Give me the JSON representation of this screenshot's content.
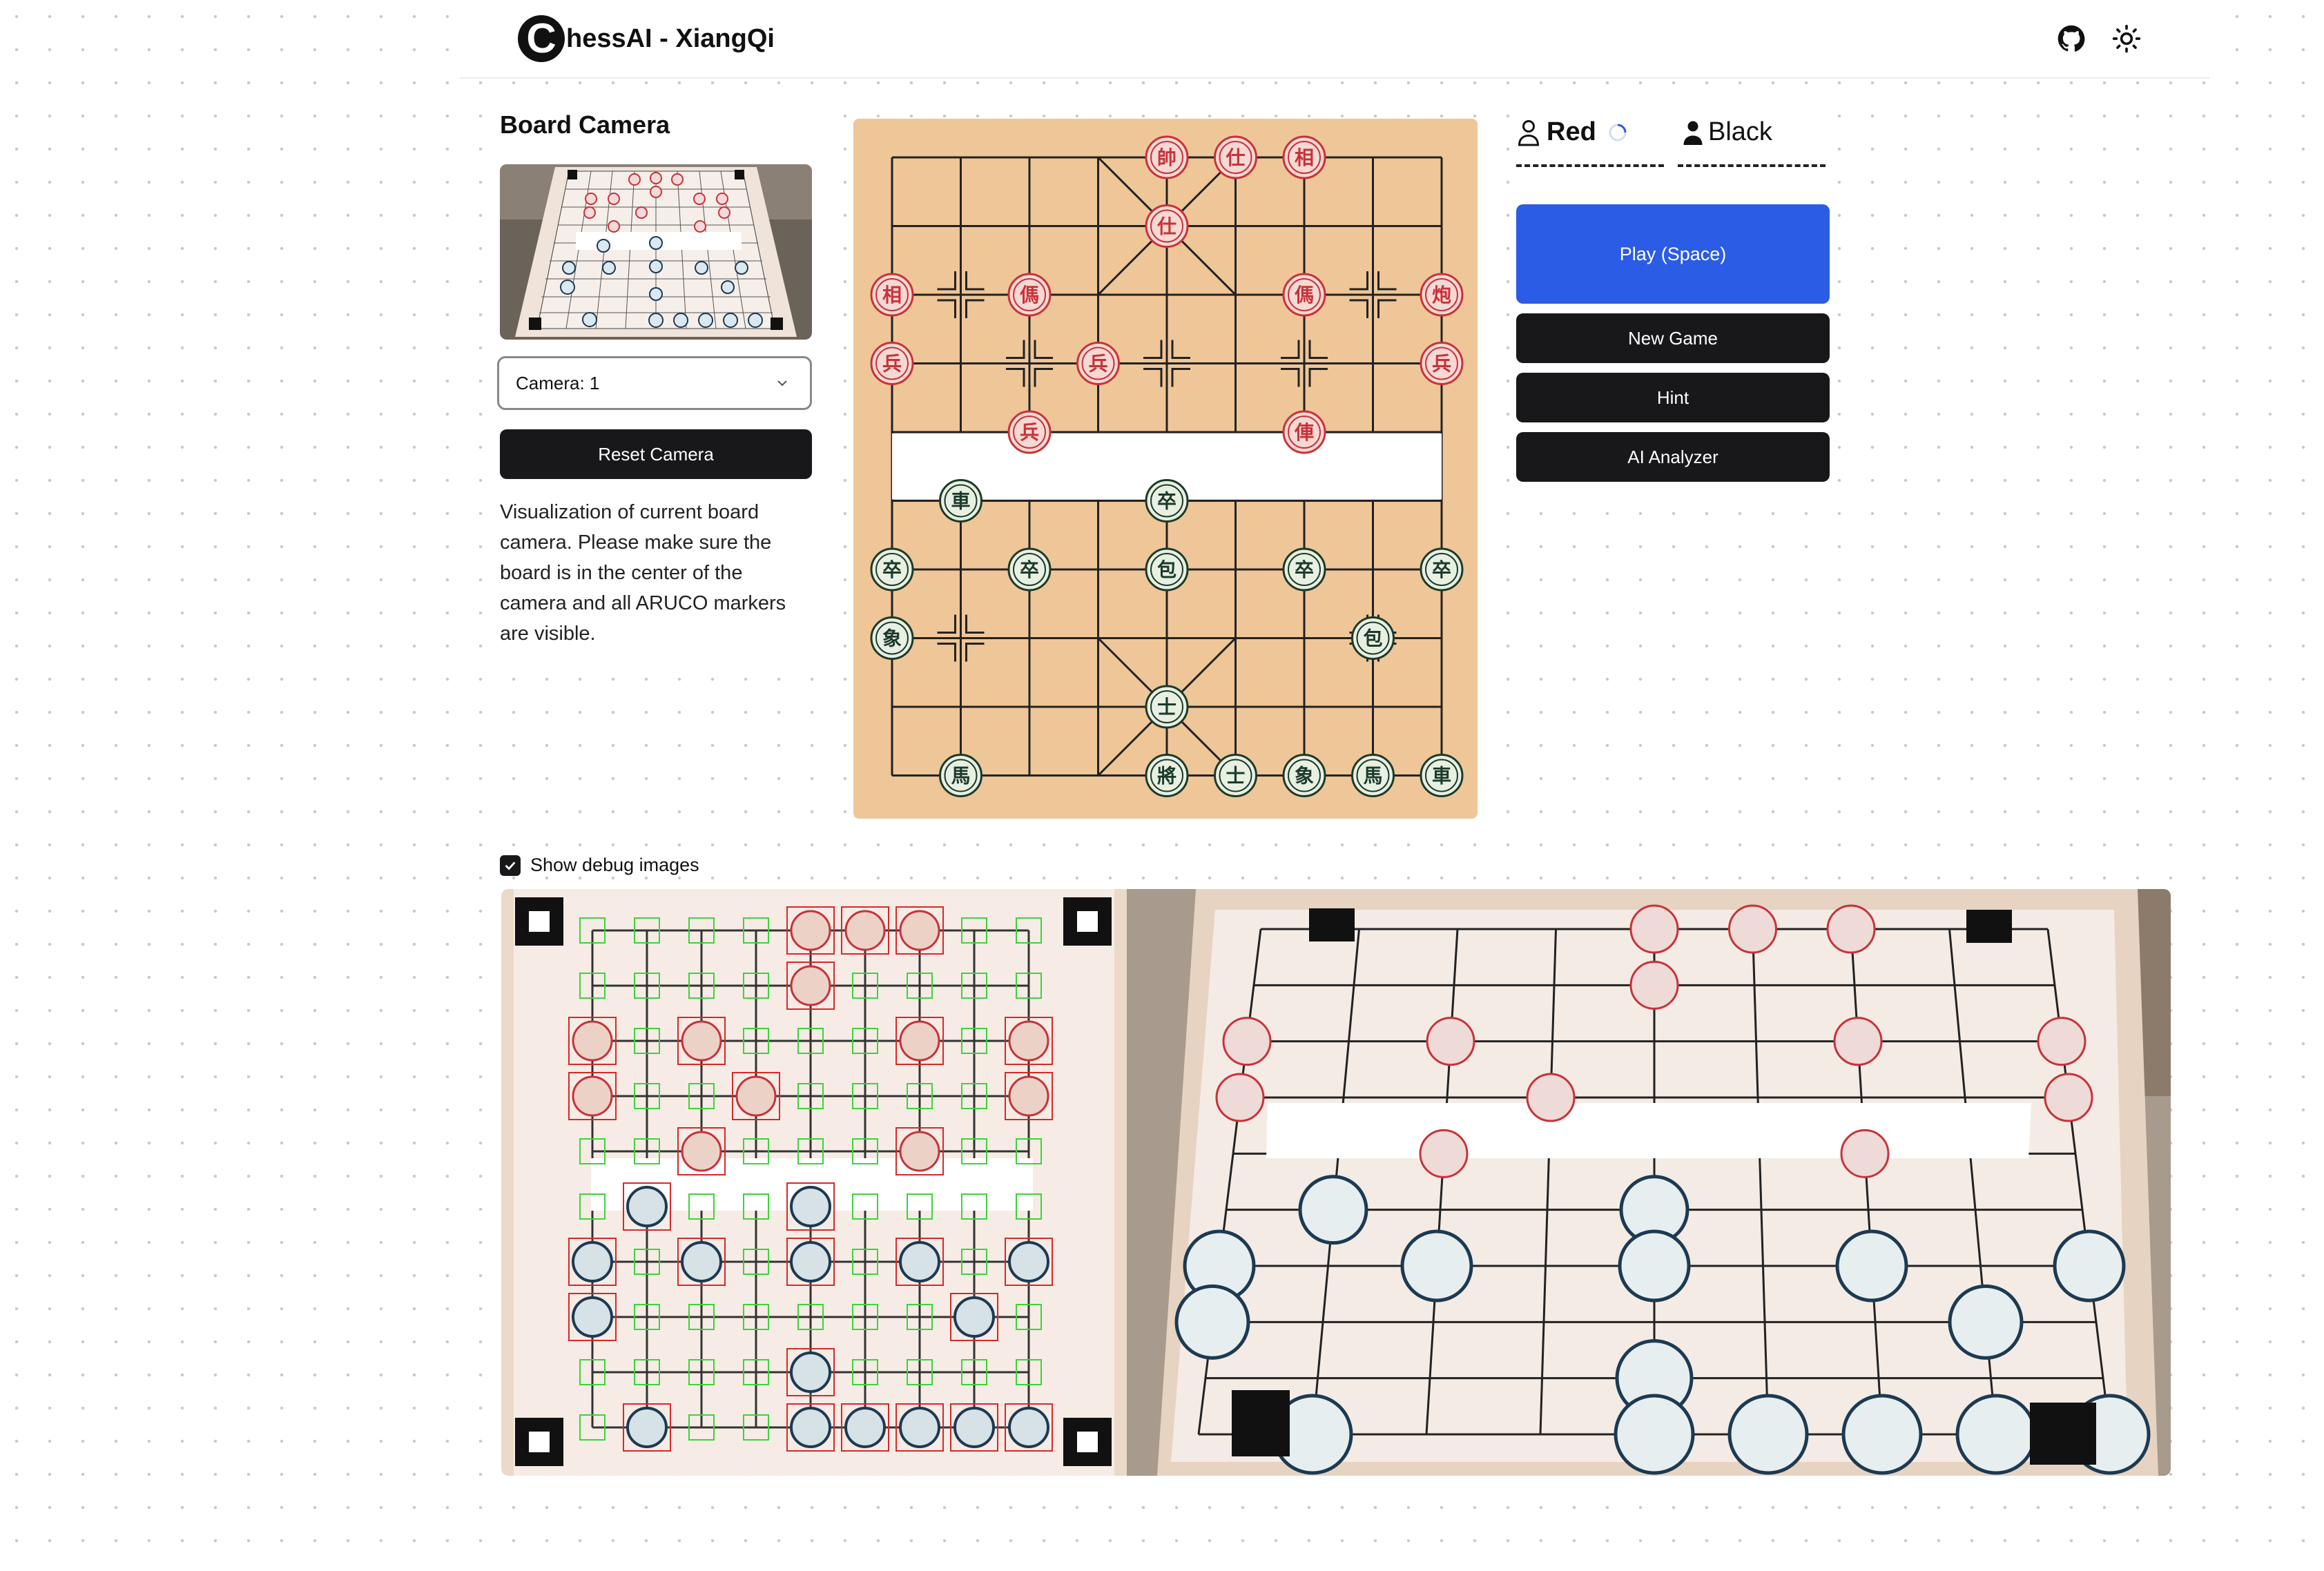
{
  "header": {
    "logo_letter": "C",
    "title": "hessAI - XiangQi",
    "github_icon": "github-icon",
    "theme_icon": "sun-icon"
  },
  "camera_panel": {
    "title": "Board Camera",
    "select_value": "Camera: 1",
    "reset_label": "Reset Camera",
    "description": "Visualization of current board camera. Please make sure the board is in the center of the camera and all ARUCO markers are visible."
  },
  "board": {
    "red_pieces": [
      {
        "col": 4,
        "row": 0,
        "label": "帥"
      },
      {
        "col": 5,
        "row": 0,
        "label": "仕"
      },
      {
        "col": 6,
        "row": 0,
        "label": "相"
      },
      {
        "col": 4,
        "row": 1,
        "label": "仕"
      },
      {
        "col": 0,
        "row": 2,
        "label": "相"
      },
      {
        "col": 2,
        "row": 2,
        "label": "傌"
      },
      {
        "col": 6,
        "row": 2,
        "label": "傌"
      },
      {
        "col": 8,
        "row": 2,
        "label": "炮"
      },
      {
        "col": 0,
        "row": 3,
        "label": "兵"
      },
      {
        "col": 3,
        "row": 3,
        "label": "兵"
      },
      {
        "col": 8,
        "row": 3,
        "label": "兵"
      },
      {
        "col": 2,
        "row": 4,
        "label": "兵"
      },
      {
        "col": 6,
        "row": 4,
        "label": "俥"
      }
    ],
    "black_pieces": [
      {
        "col": 1,
        "row": 5,
        "label": "車"
      },
      {
        "col": 4,
        "row": 5,
        "label": "卒"
      },
      {
        "col": 0,
        "row": 6,
        "label": "卒"
      },
      {
        "col": 2,
        "row": 6,
        "label": "卒"
      },
      {
        "col": 4,
        "row": 6,
        "label": "包"
      },
      {
        "col": 6,
        "row": 6,
        "label": "卒"
      },
      {
        "col": 8,
        "row": 6,
        "label": "卒"
      },
      {
        "col": 0,
        "row": 7,
        "label": "象"
      },
      {
        "col": 7,
        "row": 7,
        "label": "包"
      },
      {
        "col": 4,
        "row": 8,
        "label": "士"
      },
      {
        "col": 1,
        "row": 9,
        "label": "馬"
      },
      {
        "col": 4,
        "row": 9,
        "label": "將"
      },
      {
        "col": 5,
        "row": 9,
        "label": "士"
      },
      {
        "col": 6,
        "row": 9,
        "label": "象"
      },
      {
        "col": 7,
        "row": 9,
        "label": "馬"
      },
      {
        "col": 8,
        "row": 9,
        "label": "車"
      }
    ]
  },
  "players": {
    "red": "Red",
    "black": "Black"
  },
  "controls": {
    "play": "Play (Space)",
    "new_game": "New Game",
    "hint": "Hint",
    "analyzer": "AI Analyzer"
  },
  "debug": {
    "checkbox_label": "Show debug images",
    "checked": true
  },
  "colors": {
    "accent": "#2b5ce6",
    "dark_button": "#18181b",
    "board_bg": "#efc698",
    "red_piece": "#c8323a",
    "black_piece": "#1c3a2a"
  }
}
